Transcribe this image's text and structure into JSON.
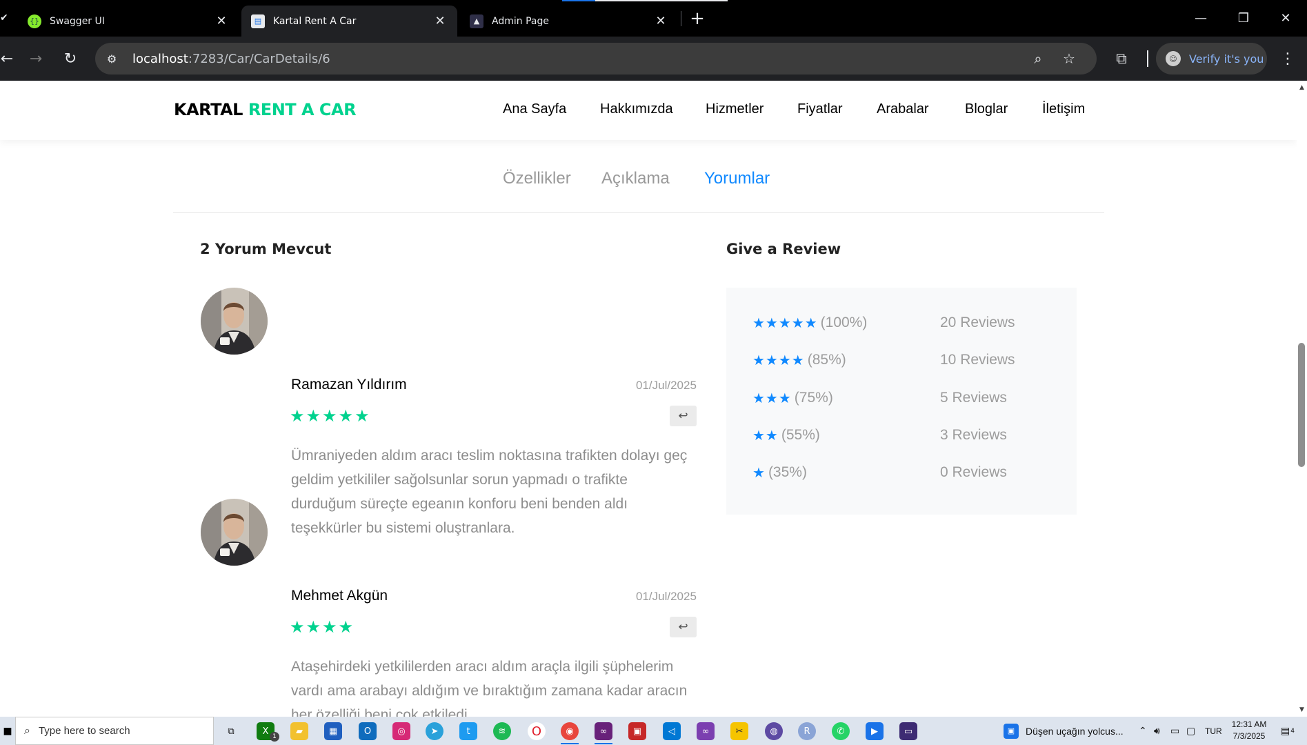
{
  "browser": {
    "tabs": [
      {
        "title": "Swagger UI",
        "icon": "swagger-icon",
        "active": false
      },
      {
        "title": "Kartal Rent A Car",
        "icon": "page-icon",
        "active": true
      },
      {
        "title": "Admin Page",
        "icon": "admin-icon",
        "active": false
      }
    ],
    "url_host": "localhost",
    "url_path": ":7283/Car/CarDetails/6",
    "profile_label": "Verify it's you"
  },
  "site": {
    "logo_part1": "KARTAL ",
    "logo_part2": "RENT A CAR",
    "nav": [
      "Ana Sayfa",
      "Hakkımızda",
      "Hizmetler",
      "Fiyatlar",
      "Arabalar",
      "Bloglar",
      "İletişim"
    ],
    "brand_color": "#01d28e",
    "accent_color": "#1089ff"
  },
  "detail_tabs": {
    "items": [
      "Özellikler",
      "Açıklama",
      "Yorumlar"
    ],
    "active": "Yorumlar"
  },
  "reviews": {
    "title": "2 Yorum Mevcut",
    "items": [
      {
        "name": "Ramazan Yıldırım",
        "date": "01/Jul/2025",
        "stars": "★★★★★",
        "rating": 5,
        "text": "Ümraniyeden aldım aracı teslim noktasına trafikten dolayı geç geldim yetkililer sağolsunlar sorun yapmadı o trafikte durduğum süreçte egeanın konforu beni benden aldı teşekkürler bu sistemi oluştranlara."
      },
      {
        "name": "Mehmet Akgün",
        "date": "01/Jul/2025",
        "stars": "★★★★",
        "rating": 4,
        "text": "Ataşehirdeki yetkililerden aracı aldım araçla ilgili şüphelerim vardı ama arabayı aldığım ve bıraktığım zamana kadar aracın her özelliği beni çok etkiledi"
      }
    ]
  },
  "give_review": {
    "title": "Give a Review",
    "rows": [
      {
        "stars": "★★★★★",
        "percent": "(100%)",
        "count": "20 Reviews"
      },
      {
        "stars": "★★★★",
        "percent": "(85%)",
        "count": "10 Reviews"
      },
      {
        "stars": "★★★",
        "percent": "(75%)",
        "count": "5 Reviews"
      },
      {
        "stars": "★★",
        "percent": "(55%)",
        "count": "3 Reviews"
      },
      {
        "stars": "★",
        "percent": "(35%)",
        "count": "0 Reviews"
      }
    ]
  },
  "taskbar": {
    "search_placeholder": "Type here to search",
    "news": "Düşen uçağın yolcus...",
    "language": "TUR",
    "time": "12:31 AM",
    "date": "7/3/2025",
    "notification_count": "4",
    "xbox_badge": "1"
  }
}
